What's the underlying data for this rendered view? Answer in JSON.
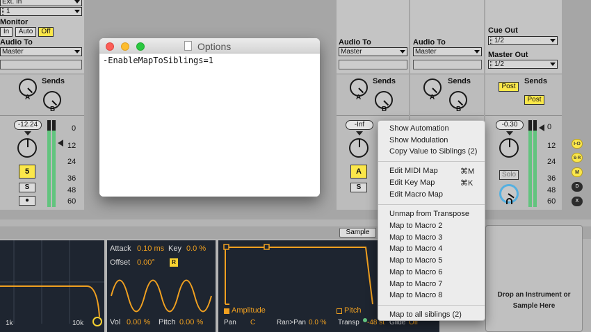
{
  "strip1": {
    "input_source": "Ext. In",
    "input_channel": "1",
    "monitor_label": "Monitor",
    "monitor_in": "In",
    "monitor_auto": "Auto",
    "monitor_off": "Off",
    "audio_to_label": "Audio To",
    "audio_to_value": "Master",
    "sends_label": "Sends",
    "send_a": "A",
    "send_b": "B",
    "volume": "-12.24",
    "track_number": "5",
    "solo": "S",
    "arm": "●",
    "scale": [
      "0",
      "12",
      "24",
      "36",
      "48",
      "60"
    ]
  },
  "strip2": {
    "audio_to_label": "Audio To",
    "audio_to_value": "Master",
    "sends_label": "Sends",
    "send_a": "A",
    "send_b": "B",
    "volume": "-Inf",
    "track_button": "A",
    "solo": "S"
  },
  "strip3": {
    "audio_to_label": "Audio To",
    "audio_to_value": "Master",
    "sends_label": "Sends",
    "send_a": "A",
    "send_b": "B"
  },
  "master": {
    "cue_out_label": "Cue Out",
    "cue_out_value": "1/2",
    "master_out_label": "Master Out",
    "master_out_value": "1/2",
    "sends_label": "Sends",
    "post_1": "Post",
    "post_2": "Post",
    "volume": "-0.30",
    "solo": "Solo",
    "scale": [
      "0",
      "12",
      "24",
      "36",
      "48",
      "60"
    ]
  },
  "right_buttons": [
    "I·O",
    "S",
    "R",
    "M",
    "D",
    "X"
  ],
  "options_window": {
    "title": "Options",
    "content": "-EnableMapToSiblings=1"
  },
  "context_menu": {
    "group1": [
      "Show Automation",
      "Show Modulation",
      "Copy Value to Siblings (2)"
    ],
    "group2": [
      {
        "label": "Edit MIDI Map",
        "shortcut": "⌘M"
      },
      {
        "label": "Edit Key Map",
        "shortcut": "⌘K"
      },
      {
        "label": "Edit Macro Map",
        "shortcut": ""
      }
    ],
    "group3": [
      "Unmap from Transpose",
      "Map to Macro 2",
      "Map to Macro 3",
      "Map to Macro 4",
      "Map to Macro 5",
      "Map to Macro 6",
      "Map to Macro 7",
      "Map to Macro 8"
    ],
    "group4": [
      "Map to all siblings (2)"
    ]
  },
  "device": {
    "sample_tab": "Sample",
    "filter_freq_1": "1k",
    "filter_freq_2": "10k",
    "lfo_attack_label": "Attack",
    "lfo_attack_value": "0.10 ms",
    "lfo_key_label": "Key",
    "lfo_key_value": "0.0 %",
    "lfo_offset_label": "Offset",
    "lfo_offset_value": "0.00°",
    "lfo_retrigger": "R",
    "vol_label": "Vol",
    "vol_value": "0.00 %",
    "pitch_label": "Pitch",
    "pitch_value": "0.00 %",
    "env_amplitude": "Amplitude",
    "env_pitch": "Pitch",
    "pan_label": "Pan",
    "pan_value": "C",
    "ran_pan_label": "Ran>Pan",
    "ran_pan_value": "0.0 %",
    "transp_label": "Transp",
    "transp_value": "-48 st",
    "glide_label": "Glide",
    "glide_value": "Off",
    "drop_text": "Drop an Instrument or Sample Here"
  },
  "colors": {
    "accent_orange": "#f0a020",
    "yellow_button": "#fbe74a",
    "meter_green": "#62c47e",
    "device_bg": "#1e2530"
  }
}
